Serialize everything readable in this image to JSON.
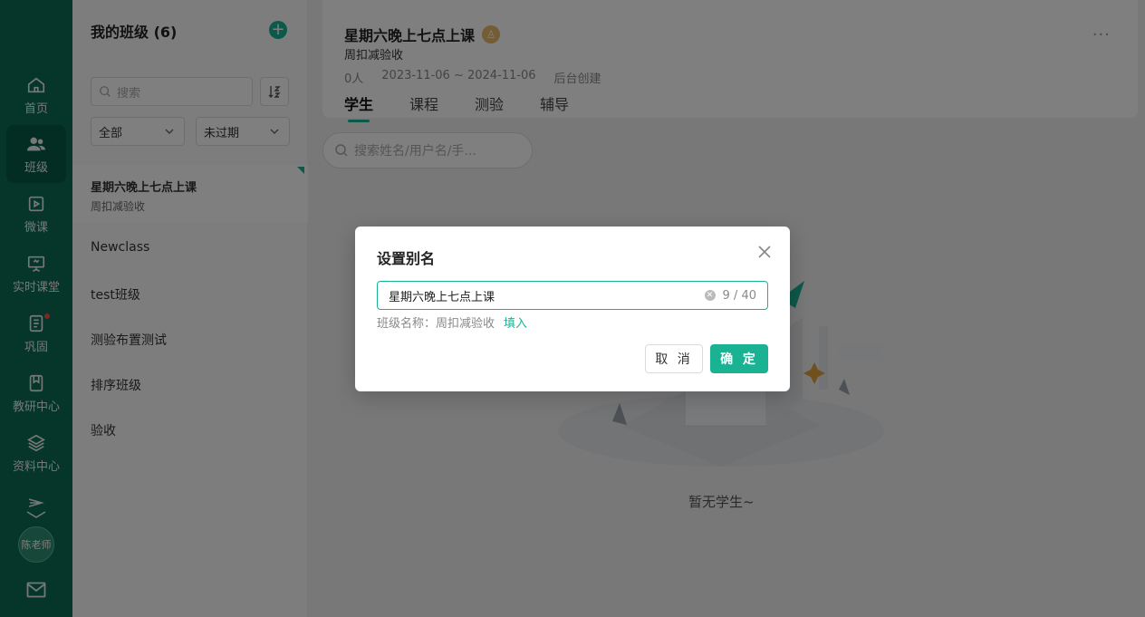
{
  "nav": {
    "items": [
      {
        "label": "首页",
        "icon": "home-icon"
      },
      {
        "label": "班级",
        "icon": "users-icon"
      },
      {
        "label": "微课",
        "icon": "video-icon"
      },
      {
        "label": "实时课堂",
        "icon": "whiteboard-icon"
      },
      {
        "label": "巩固",
        "icon": "notes-icon"
      },
      {
        "label": "教研中心",
        "icon": "book-icon"
      },
      {
        "label": "资料中心",
        "icon": "layers-icon"
      }
    ],
    "avatar_label": "陈老师"
  },
  "class_panel": {
    "title": "我的班级 (6)",
    "search_placeholder": "搜索",
    "filter_scope": "全部",
    "filter_status": "未过期",
    "classes": [
      {
        "name": "星期六晚上七点上课",
        "sub": "周扣减验收"
      },
      {
        "name": "Newclass"
      },
      {
        "name": "test班级"
      },
      {
        "name": "测验布置测试"
      },
      {
        "name": "排序班级"
      },
      {
        "name": "验收"
      }
    ]
  },
  "header": {
    "title": "星期六晚上七点上课",
    "subtitle": "周扣减验收",
    "count": "0人",
    "date_range": "2023-11-06 ~ 2024-11-06",
    "created_by": "后台创建",
    "more": "···",
    "tabs": [
      "学生",
      "课程",
      "测验",
      "辅导"
    ]
  },
  "student_search_placeholder": "搜索姓名/用户名/手...",
  "empty_text": "暂无学生~",
  "modal": {
    "title": "设置别名",
    "input_value": "星期六晚上七点上课",
    "char_count": "9 / 40",
    "hint_label": "班级名称：周扣减验收",
    "fill_link": "填入",
    "cancel_label": "取 消",
    "ok_label": "确 定"
  },
  "colors": {
    "accent": "#19b394",
    "sidebar": "#0d6b55"
  }
}
